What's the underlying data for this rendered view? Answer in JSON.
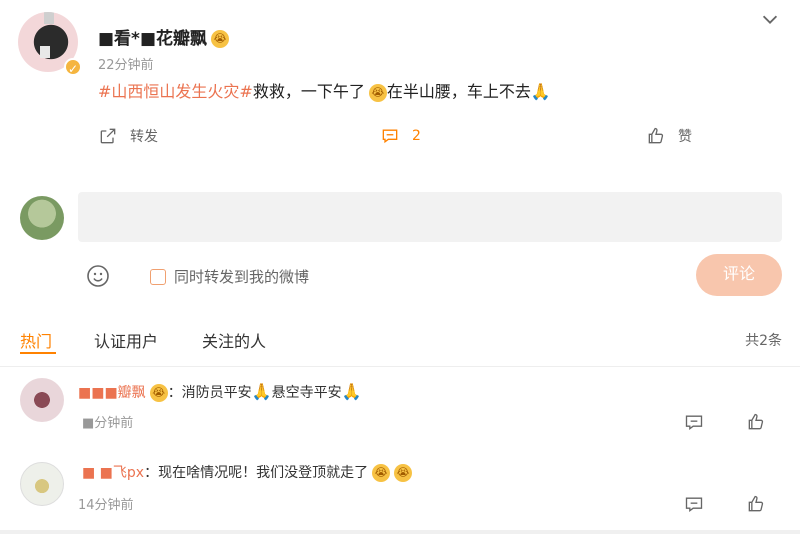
{
  "post": {
    "username": "■看*■花瓣飘",
    "timestamp": "22分钟前",
    "hashtag": "#山西恒山发生火灾#",
    "text_a": "救救，一下午了",
    "text_b": "在半山腰，车上不去",
    "actions": {
      "repost_label": "转发",
      "comment_count": "2",
      "like_label": "赞"
    }
  },
  "composer": {
    "placeholder": "",
    "repost_option_label": "同时转发到我的微博",
    "submit_label": "评论"
  },
  "tabs": [
    "热门",
    "认证用户",
    "关注的人"
  ],
  "total_label": "共2条",
  "comments": [
    {
      "name": "■■■瓣飘",
      "text": "：消防员平安",
      "text2": "悬空寺平安",
      "time": "■分钟前"
    },
    {
      "name": "■ ■飞px",
      "text": "：现在啥情况呢！我们没登顶就走了",
      "time": "14分钟前"
    }
  ],
  "colors": {
    "accent": "#ff8200",
    "hashtag": "#eb7350",
    "submit_disabled": "#f8c6ad"
  }
}
